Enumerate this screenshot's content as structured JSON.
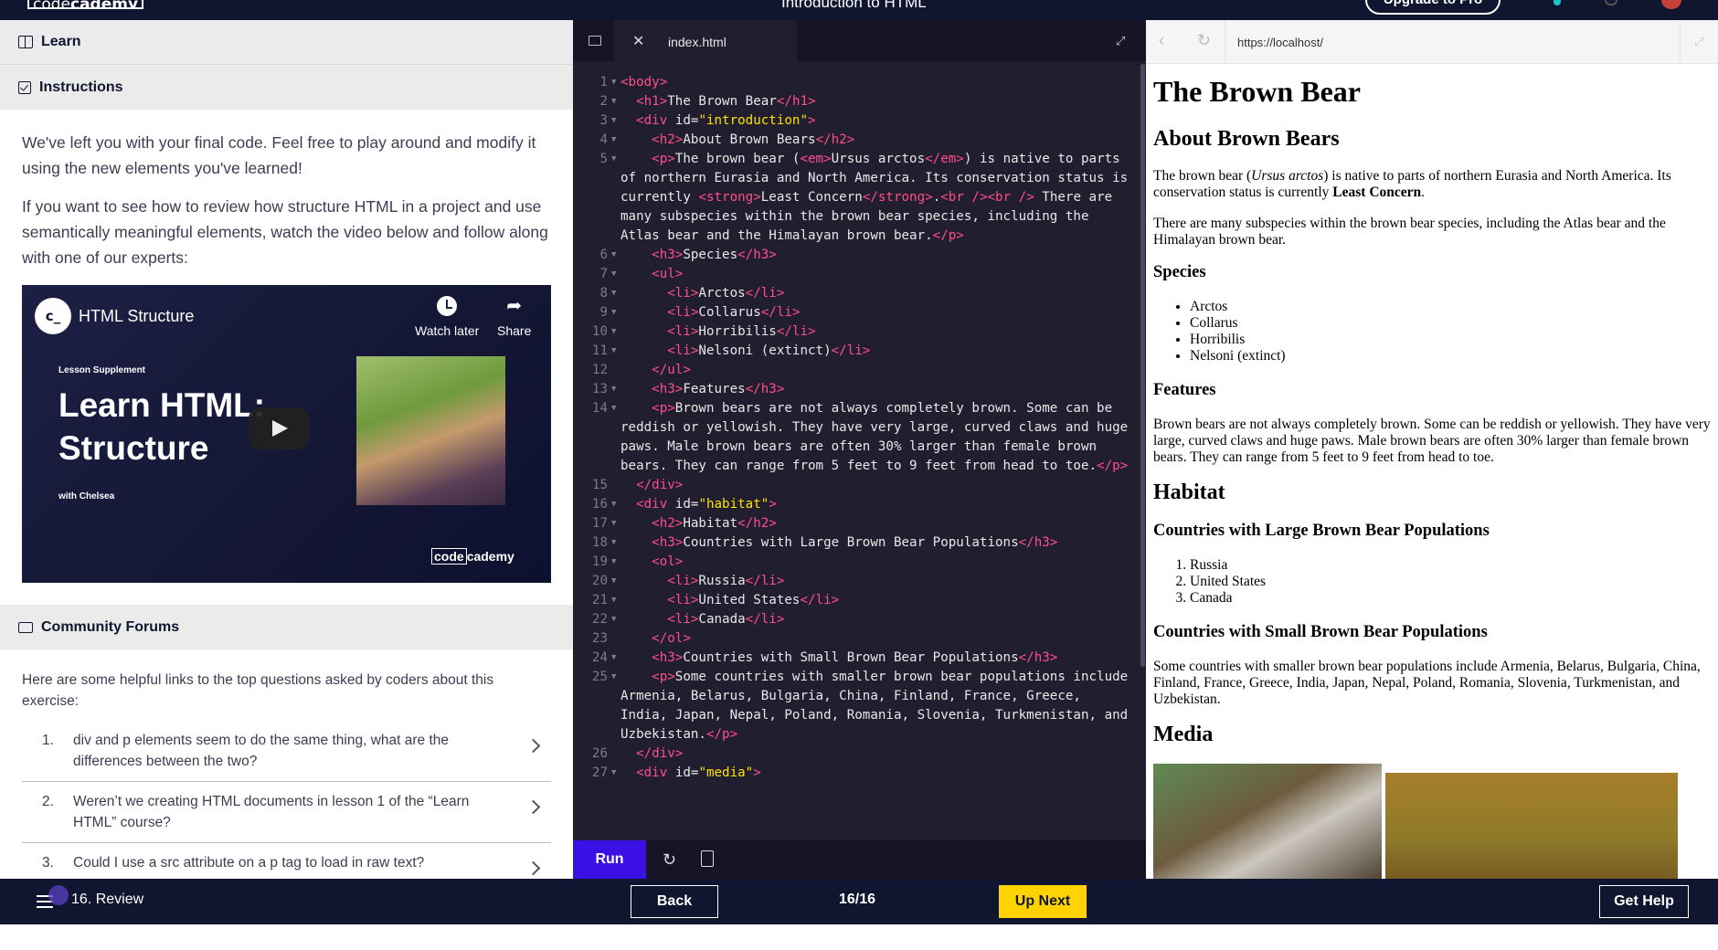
{
  "topbar": {
    "logo_code": "code",
    "logo_cademy": "cademy",
    "lesson_title": "Introduction to HTML",
    "upgrade_label": "Upgrade to Pro"
  },
  "left": {
    "learn_label": "Learn",
    "instructions_label": "Instructions",
    "paragraph1": "We've left you with your final code. Feel free to play around and modify it using the new elements you've learned!",
    "paragraph2": "If you want to see how to review how structure HTML in a project and use semantically meaningful elements, watch the video below and follow along with one of our experts:",
    "video": {
      "logo": "c_",
      "title": "HTML Structure",
      "watch_later": "Watch later",
      "share": "Share",
      "supplement": "Lesson Supplement",
      "headline": "Learn HTML: Structure",
      "with": "with Chelsea",
      "brand_code": "code",
      "brand_cademy": "cademy"
    },
    "community_label": "Community Forums",
    "forum_intro": "Here are some helpful links to the top questions asked by coders about this exercise:",
    "forum_items": [
      {
        "num": "1.",
        "text": "div and p elements seem to do the same thing, what are the differences between the two?"
      },
      {
        "num": "2.",
        "text": "Weren’t we creating HTML documents in lesson 1 of the “Learn HTML” course?"
      },
      {
        "num": "3.",
        "text": "Could I use a src attribute on a p tag to load in raw text?"
      }
    ]
  },
  "editor": {
    "tab_name": "index.html",
    "run_label": "Run",
    "line_numbers": [
      "1",
      "2",
      "3",
      "4",
      "5",
      "6",
      "7",
      "8",
      "9",
      "10",
      "11",
      "12",
      "13",
      "14",
      "15",
      "16",
      "17",
      "18",
      "19",
      "20",
      "21",
      "22",
      "23",
      "24",
      "25",
      "26",
      "27"
    ]
  },
  "browser": {
    "url": "https://localhost/",
    "h1": "The Brown Bear",
    "h2_about": "About Brown Bears",
    "p1_a": "The brown bear (",
    "p1_em": "Ursus arctos",
    "p1_b": ") is native to parts of northern Eurasia and North America. Its conservation status is currently ",
    "p1_strong": "Least Concern",
    "p1_c": ".",
    "p2": "There are many subspecies within the brown bear species, including the Atlas bear and the Himalayan brown bear.",
    "h3_species": "Species",
    "species": [
      "Arctos",
      "Collarus",
      "Horribilis",
      "Nelsoni (extinct)"
    ],
    "h3_features": "Features",
    "p_features": "Brown bears are not always completely brown. Some can be reddish or yellowish. They have very large, curved claws and huge paws. Male brown bears are often 30% larger than female brown bears. They can range from 5 feet to 9 feet from head to toe.",
    "h2_habitat": "Habitat",
    "h3_large": "Countries with Large Brown Bear Populations",
    "large_countries": [
      "Russia",
      "United States",
      "Canada"
    ],
    "h3_small": "Countries with Small Brown Bear Populations",
    "p_small": "Some countries with smaller brown bear populations include Armenia, Belarus, Bulgaria, China, Finland, France, Greece, India, Japan, Nepal, Poland, Romania, Slovenia, Turkmenistan, and Uzbekistan.",
    "h2_media": "Media"
  },
  "bottombar": {
    "lesson": "16. Review",
    "back_label": "Back",
    "progress": "16/16",
    "up_next_label": "Up Next",
    "help_label": "Get Help"
  }
}
